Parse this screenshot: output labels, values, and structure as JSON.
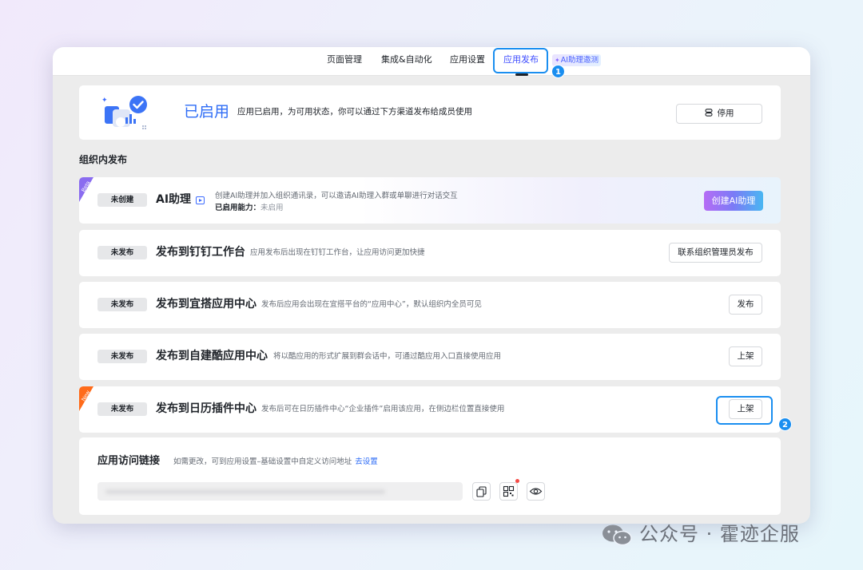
{
  "nav": {
    "tabs": [
      {
        "label": "页面管理"
      },
      {
        "label": "集成&自动化"
      },
      {
        "label": "应用设置"
      },
      {
        "label": "应用发布"
      }
    ],
    "ai_tab": "AI助理邀测",
    "active_tab": "应用发布"
  },
  "annotations": {
    "step1": "1",
    "step2": "2"
  },
  "status": {
    "title": "已启用",
    "description": "应用已启用，为可用状态，你可以通过下方渠道发布给成员使用",
    "disable_button": "停用"
  },
  "section_title": "组织内发布",
  "ai_assistant": {
    "badge": "Beta",
    "status": "未创建",
    "title": "AI助理",
    "description": "创建AI助理并加入组织通讯录，可以邀请AI助理入群或单聊进行对话交互",
    "capability_label": "已启用能力：",
    "capability_value": "未启用",
    "button": "创建AI助理"
  },
  "publish_rows": [
    {
      "status": "未发布",
      "title": "发布到钉钉工作台",
      "description": "应用发布后出现在钉钉工作台，让应用访问更加快捷",
      "button": "联系组织管理员发布"
    },
    {
      "status": "未发布",
      "title": "发布到宜搭应用中心",
      "description": "发布后应用会出现在宜搭平台的“应用中心”，默认组织内全员可见",
      "button": "发布"
    },
    {
      "status": "未发布",
      "title": "发布到自建酷应用中心",
      "description": "将以酷应用的形式扩展到群会话中，可通过酷应用入口直接使用应用",
      "button": "上架"
    },
    {
      "status": "未发布",
      "badge": "New",
      "title": "发布到日历插件中心",
      "description": "发布后可在日历插件中心“企业插件”启用该应用，在侧边栏位置直接使用",
      "button": "上架"
    }
  ],
  "access_link": {
    "title": "应用访问链接",
    "description": "如需更改，可到应用设置–基础设置中自定义访问地址",
    "link": "去设置"
  },
  "watermark": "公众号 · 霍迹企服",
  "colors": {
    "accent": "#2e6cf6",
    "annotation_blue": "#1a8ef0",
    "ai_gradient_start": "#b56cf5",
    "ai_gradient_end": "#49b7f2",
    "new_badge": "#ff6b1a",
    "beta_badge": "#8a6cf0"
  }
}
